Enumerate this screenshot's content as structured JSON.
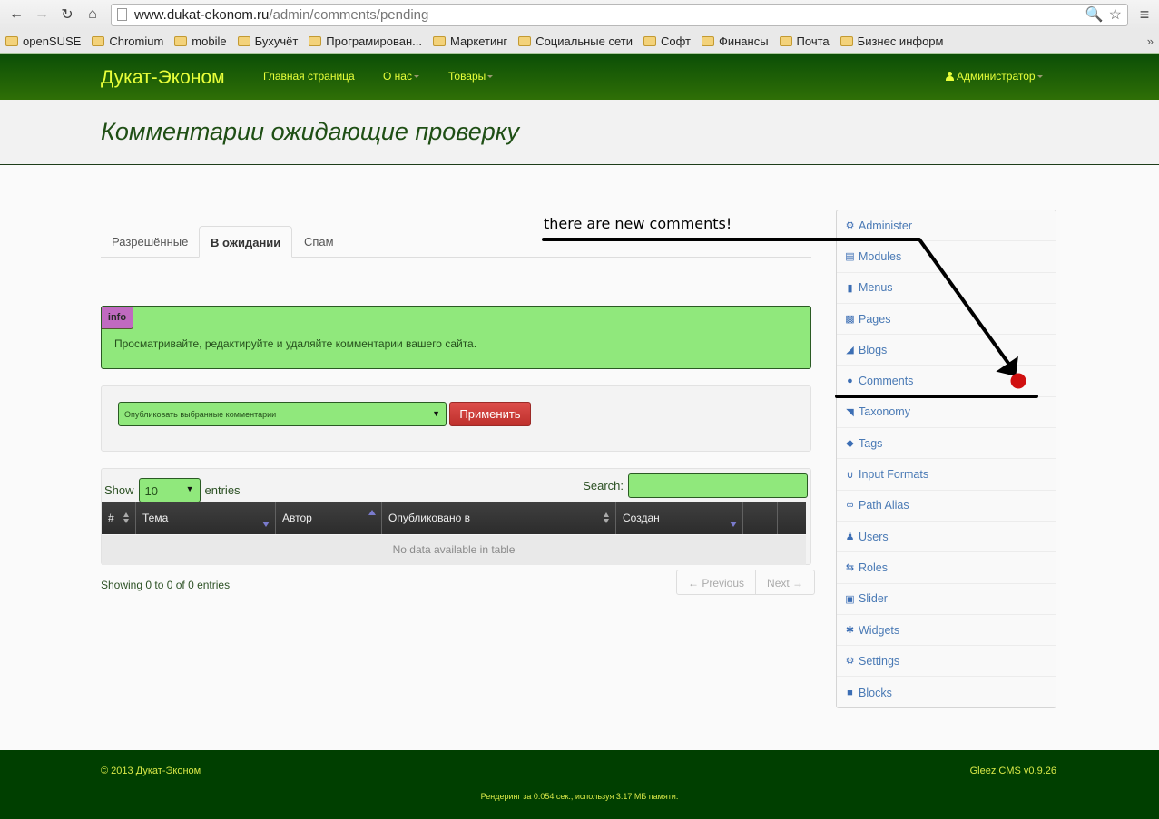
{
  "browser": {
    "url_host": "www.dukat-ekonom.ru",
    "url_path": "/admin/comments/pending",
    "bookmarks": [
      "openSUSE",
      "Chromium",
      "mobile",
      "Бухучёт",
      "Програмирован...",
      "Маркетинг",
      "Социальные сети",
      "Софт",
      "Финансы",
      "Почта",
      "Бизнес информ"
    ],
    "more": "»"
  },
  "navbar": {
    "brand": "Дукат-Эконом",
    "links": [
      "Главная страница",
      "О нас",
      "Товары"
    ],
    "user": "Администратор"
  },
  "header": {
    "title": "Комментарии ожидающие проверку"
  },
  "tabs": [
    {
      "label": "Разрешённые",
      "active": false
    },
    {
      "label": "В ожидании",
      "active": true
    },
    {
      "label": "Спам",
      "active": false
    }
  ],
  "alert": {
    "badge": "info",
    "text": "Просматривайте, редактируйте и удаляйте комментарии вашего сайта."
  },
  "bulk": {
    "selected": "Опубликовать выбранные комментарии",
    "apply": "Применить"
  },
  "datatable": {
    "show_label": "Show",
    "length_value": "10",
    "entries_label": "entries",
    "search_label": "Search:",
    "search_value": "",
    "columns": [
      "#",
      "Тема",
      "Автор",
      "Опубликовано в",
      "Создан",
      "",
      ""
    ],
    "empty": "No data available in table",
    "info": "Showing 0 to 0 of 0 entries",
    "prev": "← Previous",
    "next": "Next →"
  },
  "sidebar": {
    "items": [
      {
        "label": "Administer",
        "icon": "cog-icon"
      },
      {
        "label": "Modules",
        "icon": "list-alt-icon"
      },
      {
        "label": "Menus",
        "icon": "bookmark-icon"
      },
      {
        "label": "Pages",
        "icon": "book-icon"
      },
      {
        "label": "Blogs",
        "icon": "bullhorn-icon"
      },
      {
        "label": "Comments",
        "icon": "comment-icon"
      },
      {
        "label": "Taxonomy",
        "icon": "folder-open-icon"
      },
      {
        "label": "Tags",
        "icon": "tags-icon"
      },
      {
        "label": "Input Formats",
        "icon": "magnet-icon"
      },
      {
        "label": "Path Alias",
        "icon": "link-icon"
      },
      {
        "label": "Users",
        "icon": "user-icon"
      },
      {
        "label": "Roles",
        "icon": "retweet-icon"
      },
      {
        "label": "Slider",
        "icon": "picture-icon"
      },
      {
        "label": "Widgets",
        "icon": "asterisk-icon"
      },
      {
        "label": "Settings",
        "icon": "cogs-icon"
      },
      {
        "label": "Blocks",
        "icon": "stop-icon"
      }
    ]
  },
  "annotation": {
    "text": "there are new comments!",
    "color": "#000000",
    "dot_color": "#d01010"
  },
  "footer": {
    "copyright": "© 2013 Дукат-Эконом",
    "cms": "Gleez CMS v0.9.26",
    "render": "Рендеринг за 0.054 сек., используя 3.17 МБ памяти."
  }
}
